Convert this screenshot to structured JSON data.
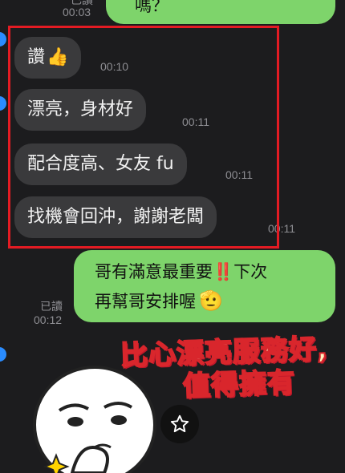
{
  "top": {
    "prev_read": "已讀",
    "prev_time": "00:03",
    "prev_outgoing_tail": "嗎？"
  },
  "messages_in": [
    {
      "text": "讚",
      "emoji": "👍",
      "time": "00:10"
    },
    {
      "text": "漂亮，身材好",
      "time": "00:11"
    },
    {
      "text": "配合度高、女友 fu",
      "time": "00:11"
    },
    {
      "text": "找機會回沖，謝謝老闆",
      "time": "00:11"
    }
  ],
  "reply": {
    "line1_prefix": "哥有滿意最重要",
    "line1_emphasis": "‼️",
    "line1_suffix": "下次",
    "line2": "再幫哥安排喔",
    "emoji": "🫡",
    "read": "已讀",
    "time": "00:12"
  },
  "sticker": {
    "line1": "比心漂亮服務好,",
    "line2": "值得擁有"
  },
  "colors": {
    "background": "#1c1c1e",
    "incoming_bubble": "#3a3a3c",
    "outgoing_bubble": "#7ed46b",
    "highlight_border": "#e31b23"
  },
  "icons": {
    "star": "star-icon"
  }
}
